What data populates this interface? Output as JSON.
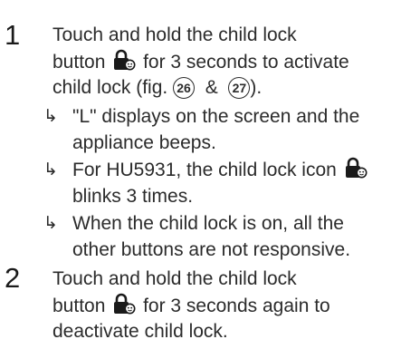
{
  "steps": [
    {
      "number": "1",
      "line1": "Touch and hold the child lock",
      "line2_before": "button",
      "line2_after": "for 3 seconds to activate",
      "line3_before": "child lock (fig.",
      "fig_a": "26",
      "amp": "&",
      "fig_b": "27",
      "line3_after": ").",
      "bullets": [
        {
          "arrow": "↳",
          "line1": "\"L\" displays on the screen and the",
          "line2": "appliance beeps."
        },
        {
          "arrow": "↳",
          "line1": "For HU5931, the child lock icon",
          "line2": "blinks 3 times."
        },
        {
          "arrow": "↳",
          "line1": "When the child lock is on, all the",
          "line2": "other buttons are not responsive."
        }
      ]
    },
    {
      "number": "2",
      "line1": "Touch and hold the child lock",
      "line2_before": "button",
      "line2_after": "for 3 seconds again to",
      "line3": "deactivate child lock."
    }
  ],
  "icons": {
    "child_lock": "child-lock-icon"
  }
}
